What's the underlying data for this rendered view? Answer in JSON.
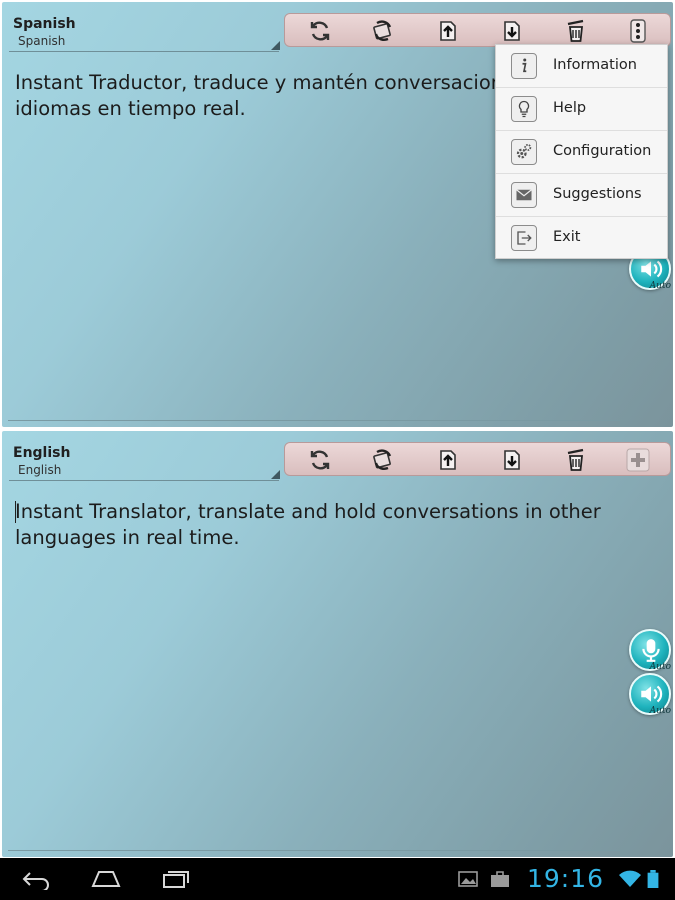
{
  "source_panel": {
    "language": "Spanish",
    "language_sub": "Spanish",
    "text_line1": "Instant Traductor, traduce y mantén conversaciones en otros",
    "text_line2": "idiomas en tiempo real."
  },
  "target_panel": {
    "language": "English",
    "language_sub": "English",
    "text_line1": "Instant Translator, translate and hold conversations in other",
    "text_line2": "languages in real time."
  },
  "toolbar_icons": [
    "refresh-icon",
    "swap-icon",
    "upload-icon",
    "download-icon",
    "trash-icon",
    "overflow-menu-icon",
    "add-icon"
  ],
  "speech_buttons": {
    "auto_label": "Auto"
  },
  "menu": {
    "items": [
      {
        "label": "Information",
        "icon": "info-icon"
      },
      {
        "label": "Help",
        "icon": "lightbulb-icon"
      },
      {
        "label": "Configuration",
        "icon": "gears-icon"
      },
      {
        "label": "Suggestions",
        "icon": "envelope-icon"
      },
      {
        "label": "Exit",
        "icon": "exit-icon"
      }
    ]
  },
  "system_bar": {
    "time": "19:16"
  },
  "colors": {
    "accent_clock": "#33b5e5",
    "speech_button": "#1fb3bd",
    "toolbar_bg": "#e3cccc"
  }
}
